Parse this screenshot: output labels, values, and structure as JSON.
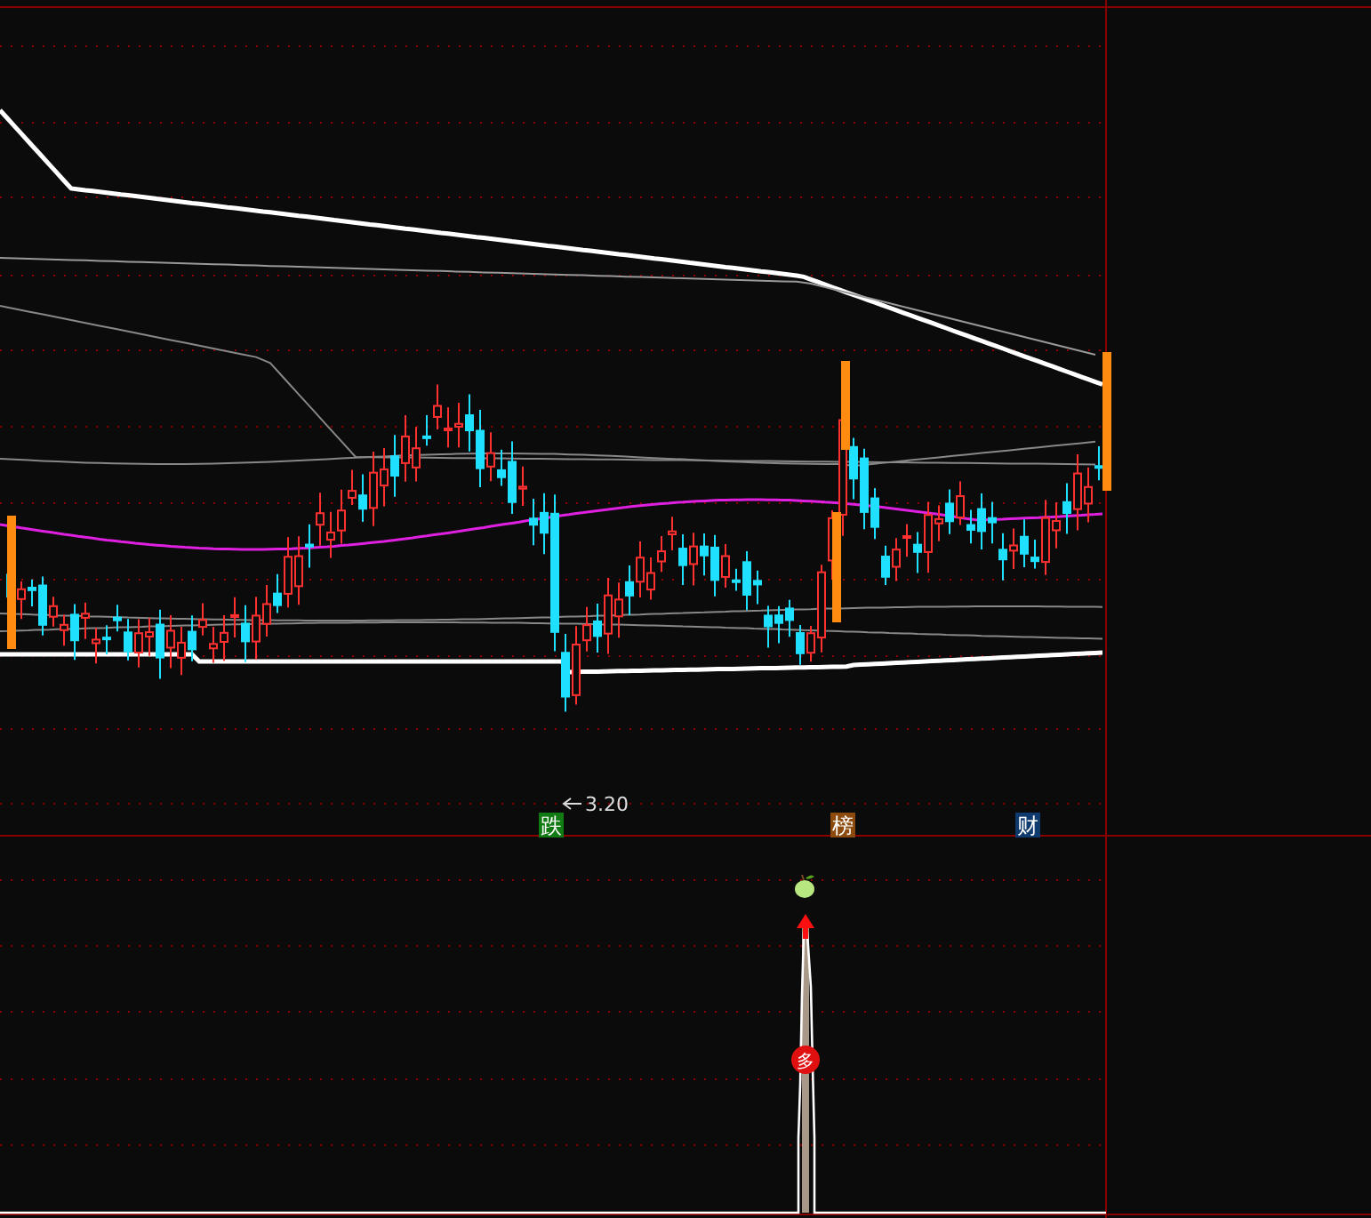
{
  "main_chart": {
    "low_price_label": "3.20",
    "signal_tags": [
      {
        "text": "跌",
        "color": "#127a12"
      },
      {
        "text": "榜",
        "color": "#8c4a0c"
      },
      {
        "text": "财",
        "color": "#0f3a6e"
      }
    ]
  },
  "indicator_panel": {
    "signal_badge": "多"
  }
}
